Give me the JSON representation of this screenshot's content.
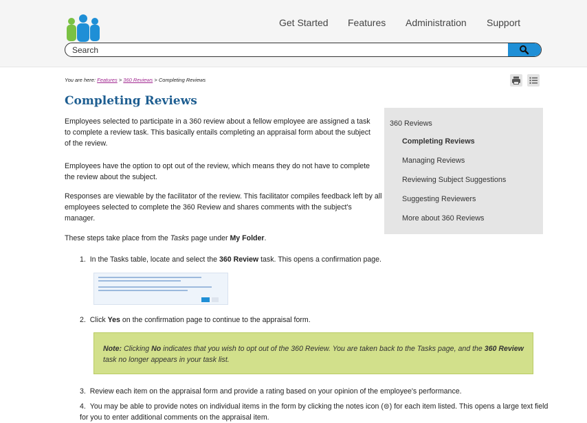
{
  "nav": {
    "items": [
      "Get Started",
      "Features",
      "Administration",
      "Support"
    ]
  },
  "search": {
    "placeholder": "Search"
  },
  "icons": {
    "logo": "people-logo-icon",
    "search": "search-icon",
    "print": "print-icon",
    "toc": "list-icon",
    "notes": "notes-icon"
  },
  "colors": {
    "brand_blue": "#1f8fd6",
    "logo_green": "#7ac143",
    "title_blue": "#1e5e91",
    "link_purple": "#a0268f",
    "note_bg": "#d2e08b",
    "sidebar_bg": "#e5e5e5"
  },
  "breadcrumb": {
    "prefix": "You are here: ",
    "link1": "Features",
    "sep1": " > ",
    "link2": "360 Reviews",
    "sep2": " > ",
    "current": "Completing Reviews"
  },
  "page": {
    "title": "Completing Reviews",
    "para1": "Employees selected to participate in a 360 review about a fellow employee are assigned a task to complete a review task. This basically entails completing an appraisal form about the subject of the review.",
    "para2": "Employees have the option to opt out of the review, which means they do not have to complete the review about the subject.",
    "para3": "Responses are viewable by the facilitator of the review. This facilitator compiles feedback left by all employees selected to complete the 360 Review and shares comments with the subject's manager.",
    "steps_intro": {
      "a": "These steps take place from the ",
      "b": "Tasks",
      "c": " page under ",
      "d": "My Folder",
      "e": "."
    },
    "step1": {
      "num": "1.",
      "a": "In the Tasks table, locate and select the ",
      "b": "360 Review",
      "c": " task. This opens a confirmation page."
    },
    "step2": {
      "num": "2.",
      "a": "Click ",
      "b": "Yes",
      "c": " on the confirmation page to continue to the appraisal form."
    },
    "note": {
      "label": "Note:",
      "a": " Clicking ",
      "b": "No",
      "c": " indicates that you wish to opt out of the 360 Review. You are taken back to the Tasks page, and the ",
      "d": "360 Review",
      "e": " task no longer appears in your task list."
    },
    "step3": {
      "num": "3.",
      "text": "Review each item on the appraisal form and provide a rating based on your opinion of the employee's performance."
    },
    "step4": {
      "num": "4.",
      "a": "You may be able to provide notes on individual items in the form by clicking the notes icon (",
      "icon": "⊜",
      "b": ") for each item listed. This opens a large text field for you to enter additional comments on the appraisal item."
    }
  },
  "sidebar": {
    "items": [
      "360 Reviews",
      "Completing Reviews",
      "Managing Reviews",
      "Reviewing Subject Suggestions",
      "Suggesting Reviewers",
      "More about 360 Reviews"
    ]
  }
}
